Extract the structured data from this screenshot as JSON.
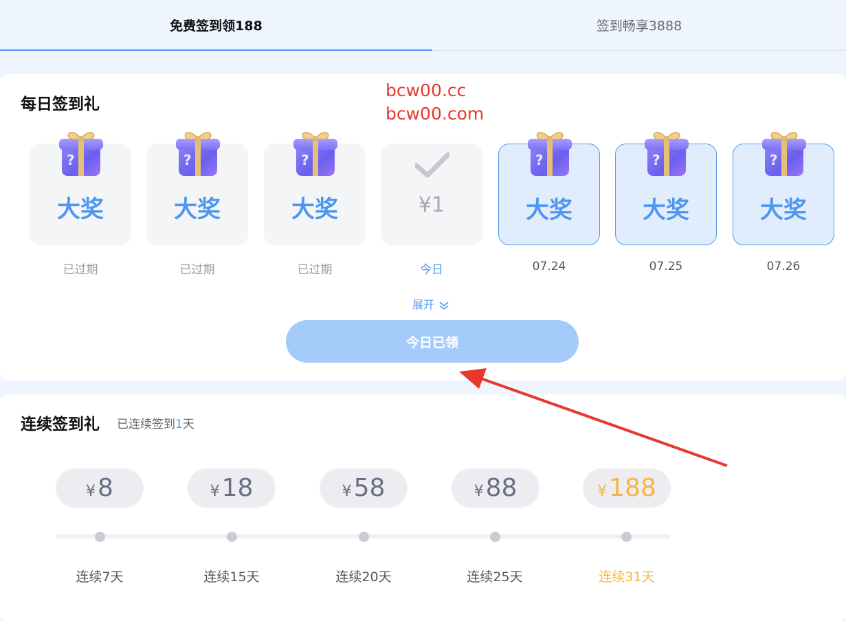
{
  "tabs": [
    {
      "label": "免费签到领188",
      "active": true
    },
    {
      "label": "签到畅享3888",
      "active": false
    }
  ],
  "watermark": {
    "line1": "bcw00.cc",
    "line2": "bcw00.com"
  },
  "daily": {
    "title": "每日签到礼",
    "days": [
      {
        "state": "expired",
        "prize": "大奖",
        "label": "已过期"
      },
      {
        "state": "expired",
        "prize": "大奖",
        "label": "已过期"
      },
      {
        "state": "expired",
        "prize": "大奖",
        "label": "已过期"
      },
      {
        "state": "claimed",
        "amount": "¥1",
        "label": "今日"
      },
      {
        "state": "future",
        "prize": "大奖",
        "label": "07.24"
      },
      {
        "state": "future",
        "prize": "大奖",
        "label": "07.25"
      },
      {
        "state": "future",
        "prize": "大奖",
        "label": "07.26"
      }
    ],
    "expand_label": "展开",
    "claim_button": "今日已领"
  },
  "streak": {
    "title": "连续签到礼",
    "note_prefix": "已连续签到",
    "note_count": "1",
    "note_suffix": "天",
    "currency": "¥",
    "rewards": [
      {
        "value": "8",
        "label": "连续7天",
        "highlight": false
      },
      {
        "value": "18",
        "label": "连续15天",
        "highlight": false
      },
      {
        "value": "58",
        "label": "连续20天",
        "highlight": false
      },
      {
        "value": "88",
        "label": "连续25天",
        "highlight": false
      },
      {
        "value": "188",
        "label": "连续31天",
        "highlight": true
      }
    ]
  },
  "colors": {
    "accent": "#4d97f0",
    "gold": "#f5b544",
    "annotation": "#e8372c"
  }
}
